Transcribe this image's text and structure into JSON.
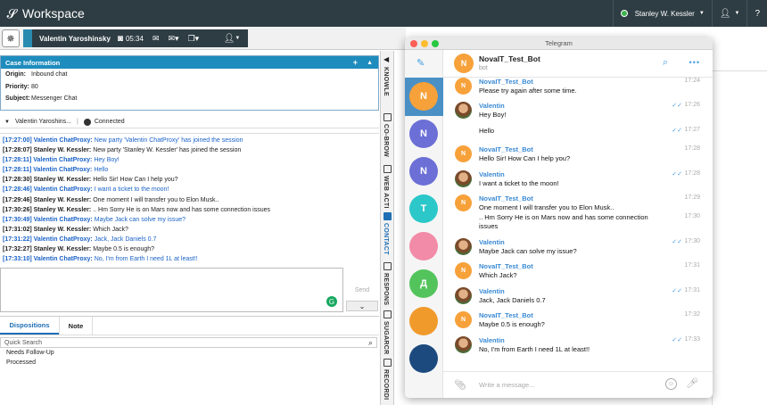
{
  "app": {
    "title": "Workspace",
    "agent_name": "Stanley W. Kessler",
    "status_color": "#3fb24f"
  },
  "toolbar": {
    "contact_name": "Valentin Yaroshinsky",
    "timer": "05:34"
  },
  "case_info": {
    "header": "Case Information",
    "add_label": "+",
    "collapse_label": "▲",
    "fields": [
      {
        "key": "Origin:",
        "value": "Inbound chat"
      },
      {
        "key": "Priority:",
        "value": "80"
      },
      {
        "key": "Subject:",
        "value": "Messenger Chat"
      }
    ]
  },
  "participants": {
    "name": "Valentin Yaroshins...",
    "status": "Connected"
  },
  "transcript": [
    {
      "ts": "[17:27:00]",
      "author": "Valentin ChatProxy:",
      "text": "New party 'Valentin ChatProxy' has joined the session",
      "color": "blue"
    },
    {
      "ts": "[17:28:07]",
      "author": "Stanley W. Kessler:",
      "text": "New party 'Stanley W. Kessler' has joined the session",
      "color": "black"
    },
    {
      "ts": "[17:28:11]",
      "author": "Valentin ChatProxy:",
      "text": "Hey Boy!",
      "color": "blue"
    },
    {
      "ts": "[17:28:11]",
      "author": "Valentin ChatProxy:",
      "text": "Hello",
      "color": "blue"
    },
    {
      "ts": "[17:28:30]",
      "author": "Stanley W. Kessler:",
      "text": "Hello Sir! How Can I help you?",
      "color": "black"
    },
    {
      "ts": "[17:28:46]",
      "author": "Valentin ChatProxy:",
      "text": "I want a ticket to the moon!",
      "color": "blue"
    },
    {
      "ts": "[17:29:46]",
      "author": "Stanley W. Kessler:",
      "text": "One moment I will transfer you to Elon Musk..",
      "color": "black"
    },
    {
      "ts": "[17:30:26]",
      "author": "Stanley W. Kessler:",
      "text": ".. Hm Sorry He is on Mars now and has some connection issues",
      "color": "black"
    },
    {
      "ts": "[17:30:49]",
      "author": "Valentin ChatProxy:",
      "text": "Maybe Jack can solve my issue?",
      "color": "blue"
    },
    {
      "ts": "[17:31:02]",
      "author": "Stanley W. Kessler:",
      "text": "Which Jack?",
      "color": "black"
    },
    {
      "ts": "[17:31:22]",
      "author": "Valentin ChatProxy:",
      "text": "Jack, Jack Daniels 0.7",
      "color": "blue"
    },
    {
      "ts": "[17:32:27]",
      "author": "Stanley W. Kessler:",
      "text": "Maybe 0.5 is enough?",
      "color": "black"
    },
    {
      "ts": "[17:33:10]",
      "author": "Valentin ChatProxy:",
      "text": "No, I'm from Earth I need 1L at least!!",
      "color": "blue"
    }
  ],
  "compose": {
    "send_label": "Send"
  },
  "dispositions": {
    "tabs": [
      "Dispositions",
      "Note"
    ],
    "search_placeholder": "Quick Search",
    "items": [
      "Needs Follow-Up",
      "Processed"
    ]
  },
  "sidebar_tabs": [
    "KNOWLE",
    "CO-BROW",
    "WEB ACTI",
    "CONTACT",
    "RESPONS",
    "SUGARCR",
    "RECORDI"
  ],
  "telegram": {
    "window_title": "Telegram",
    "chat_name": "NovaIT_Test_Bot",
    "chat_sub": "bot",
    "input_placeholder": "Write a message...",
    "chat_list": [
      {
        "letter": "N",
        "color": "#f7a13a"
      },
      {
        "letter": "N",
        "color": "#6c6fd6"
      },
      {
        "letter": "N",
        "color": "#6c6fd6"
      },
      {
        "letter": "T",
        "color": "#2cc7c9"
      },
      {
        "letter": "",
        "color": "#f28ba8"
      },
      {
        "letter": "Д",
        "color": "#53c45c"
      },
      {
        "letter": "",
        "color": "#f19a2c"
      },
      {
        "letter": "",
        "color": "#1c4a7e"
      }
    ],
    "messages": [
      {
        "from": "bot",
        "name": "NovaIT_Test_Bot",
        "text": "Please try again after some time.",
        "time": "17:24",
        "read": false,
        "avatar": "N"
      },
      {
        "from": "user",
        "name": "Valentin",
        "text": "Hey Boy!",
        "time": "17:26",
        "read": true,
        "avatar": ""
      },
      {
        "from": "user",
        "name": "",
        "text": "Hello",
        "time": "17:27",
        "read": true,
        "avatar": ""
      },
      {
        "from": "bot",
        "name": "NovaIT_Test_Bot",
        "text": "Hello Sir! How Can I help you?",
        "time": "17:28",
        "read": false,
        "avatar": "N"
      },
      {
        "from": "user",
        "name": "Valentin",
        "text": "I want a ticket to the moon!",
        "time": "17:28",
        "read": true,
        "avatar": ""
      },
      {
        "from": "bot",
        "name": "NovaIT_Test_Bot",
        "text": "One moment I will transfer you to Elon Musk..",
        "time": "17:29",
        "read": false,
        "avatar": "N"
      },
      {
        "from": "bot",
        "name": "",
        "text": ".. Hm Sorry He is on Mars now and has some connection issues",
        "time": "17:30",
        "read": false,
        "avatar": ""
      },
      {
        "from": "user",
        "name": "Valentin",
        "text": "Maybe Jack can solve my issue?",
        "time": "17:30",
        "read": true,
        "avatar": ""
      },
      {
        "from": "bot",
        "name": "NovaIT_Test_Bot",
        "text": "Which Jack?",
        "time": "17:31",
        "read": false,
        "avatar": "N"
      },
      {
        "from": "user",
        "name": "Valentin",
        "text": "Jack, Jack Daniels 0.7",
        "time": "17:31",
        "read": true,
        "avatar": ""
      },
      {
        "from": "bot",
        "name": "NovaIT_Test_Bot",
        "text": "Maybe 0.5 is enough?",
        "time": "17:32",
        "read": false,
        "avatar": "N"
      },
      {
        "from": "user",
        "name": "Valentin",
        "text": "No, I'm from Earth I need 1L at least!!",
        "time": "17:33",
        "read": true,
        "avatar": ""
      }
    ]
  }
}
